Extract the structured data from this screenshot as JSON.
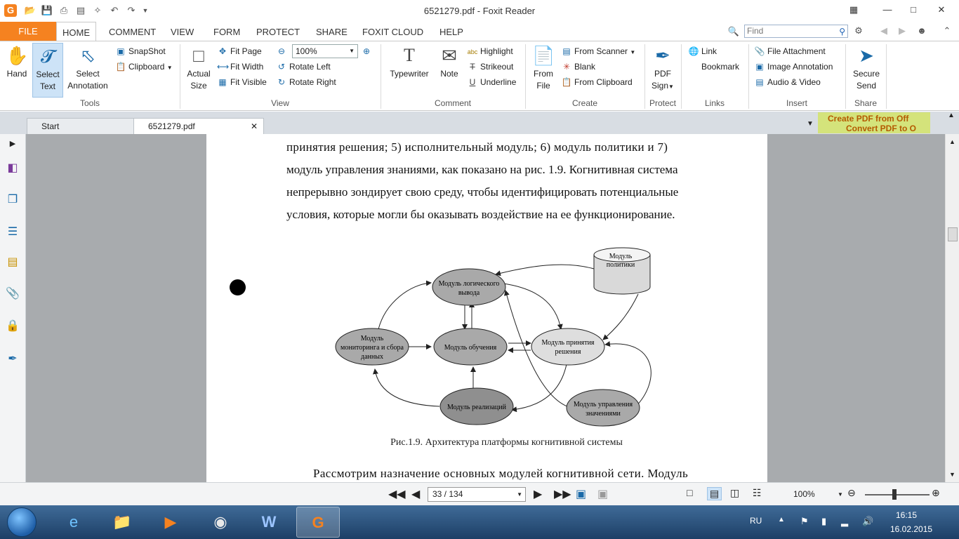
{
  "window": {
    "title": "6521279.pdf - Foxit Reader",
    "app_logo": "G"
  },
  "menu": {
    "file": "FILE",
    "tabs": [
      "HOME",
      "COMMENT",
      "VIEW",
      "FORM",
      "PROTECT",
      "SHARE",
      "FOXIT CLOUD",
      "HELP"
    ],
    "find_placeholder": "Find"
  },
  "ribbon": {
    "tools": {
      "label": "Tools",
      "hand": "Hand",
      "select_text_1": "Select",
      "select_text_2": "Text",
      "select_annot_1": "Select",
      "select_annot_2": "Annotation",
      "snapshot": "SnapShot",
      "clipboard": "Clipboard"
    },
    "view": {
      "label": "View",
      "actual_1": "Actual",
      "actual_2": "Size",
      "fit_page": "Fit Page",
      "fit_width": "Fit Width",
      "fit_visible": "Fit Visible",
      "rotate_left": "Rotate Left",
      "rotate_right": "Rotate Right",
      "zoom": "100%"
    },
    "comment": {
      "label": "Comment",
      "typewriter": "Typewriter",
      "note": "Note",
      "highlight": "Highlight",
      "strikeout": "Strikeout",
      "underline": "Underline"
    },
    "create": {
      "label": "Create",
      "from_file_1": "From",
      "from_file_2": "File",
      "from_scanner": "From Scanner",
      "blank": "Blank",
      "from_clipboard": "From Clipboard"
    },
    "protect": {
      "label": "Protect",
      "pdf_sign_1": "PDF",
      "pdf_sign_2": "Sign"
    },
    "links": {
      "label": "Links",
      "link": "Link",
      "bookmark": "Bookmark"
    },
    "insert": {
      "label": "Insert",
      "file_attachment": "File Attachment",
      "image_annotation": "Image Annotation",
      "audio_video": "Audio & Video"
    },
    "share": {
      "label": "Share",
      "secure_1": "Secure",
      "secure_2": "Send"
    }
  },
  "doc_tabs": {
    "start": "Start",
    "current": "6521279.pdf",
    "ad_line1": "Create PDF from Off",
    "ad_line2": "Convert PDF to O"
  },
  "page": {
    "lines": [
      "принятия решения; 5) исполнительный модуль; 6) модуль политики и 7)",
      "модуль управления знаниями, как показано на рис. 1.9. Когнитивная система",
      "непрерывно зондирует свою среду, чтобы идентифицировать потенциальные",
      "условия, которые могли бы оказывать воздействие на ее функционирование."
    ],
    "caption": "Рис.1.9. Архитектура платформы когнитивной системы",
    "bottom_line": "Рассмотрим назначение основных модулей когнитивной сети. Модуль"
  },
  "diagram": {
    "policy_1": "Модуль",
    "policy_2": "политики",
    "logic_1": "Модуль логического",
    "logic_2": "вывода",
    "monitor_1": "Модуль",
    "monitor_2": "мониторинга и сбора",
    "monitor_3": "данных",
    "learning": "Модуль обучения",
    "decision_1": "Модуль принятия",
    "decision_2": "решения",
    "realization": "Модуль реализаций",
    "knowledge_1": "Модуль управления",
    "knowledge_2": "значениями"
  },
  "status": {
    "page_field": "33 / 134",
    "zoom": "100%"
  },
  "taskbar": {
    "lang": "RU",
    "time": "16:15",
    "date": "16.02.2015"
  },
  "colors": {
    "accent": "#f58220",
    "ribbon_icon": "#1a6aa8",
    "viewer_bg": "#a8abae"
  }
}
